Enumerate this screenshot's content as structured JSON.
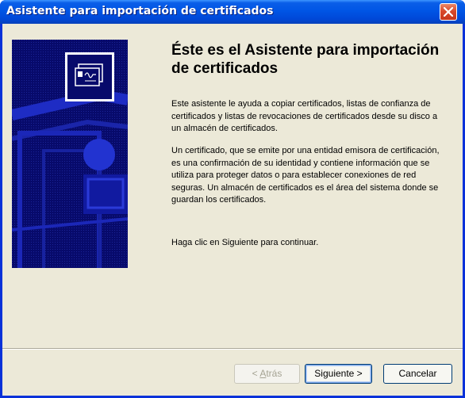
{
  "window": {
    "title": "Asistente para importación de certificados"
  },
  "content": {
    "heading": "Éste es el Asistente para importación de certificados",
    "paragraph1": "Este asistente le ayuda a copiar certificados, listas de confianza de certificados y listas de revocaciones de certificados desde su disco a un almacén de certificados.",
    "paragraph2": "Un certificado, que se emite por una entidad emisora de certificación, es una confirmación de su identidad y contiene información que se utiliza para proteger datos o para establecer conexiones de red seguras. Un almacén de certificados es el área del sistema donde se guardan los certificados.",
    "paragraph3": "Haga clic en Siguiente para continuar."
  },
  "buttons": {
    "back": {
      "prefix": "< ",
      "accel": "A",
      "rest": "trás",
      "enabled": false
    },
    "next": {
      "label": "Siguiente >",
      "enabled": true
    },
    "cancel": {
      "label": "Cancelar",
      "enabled": true
    }
  },
  "colors": {
    "titlebar": "#0055e5",
    "client": "#ece9d8",
    "banner": "#070a6b",
    "close": "#d9492b"
  },
  "icons": {
    "close": "close-icon",
    "banner": "certificate-icon"
  }
}
